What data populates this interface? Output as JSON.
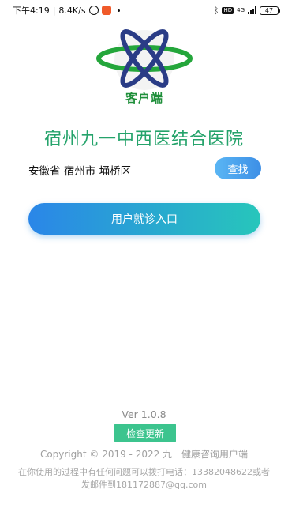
{
  "status_bar": {
    "time": "下午4:19",
    "network_speed": "8.4K/s",
    "network_type": "4G",
    "battery": "47"
  },
  "logo": {
    "text": "客户端",
    "colors": {
      "ring": "#24a63b",
      "atom": "#2a3c86",
      "text": "#1f8f3a"
    }
  },
  "hospital": {
    "name": "宿州九一中西医结合医院",
    "region": "安徽省 宿州市 埇桥区"
  },
  "buttons": {
    "search_label": "查找",
    "entry_label": "用户就诊入口",
    "update_label": "检查更新"
  },
  "footer": {
    "version": "Ver 1.0.8",
    "copyright": "Copyright © 2019 - 2022 九一健康咨询用户端",
    "contact_line1": "在你使用的过程中有任何问题可以拨打电话：13382048622或者",
    "contact_line2": "发邮件到181172887@qq.com"
  }
}
